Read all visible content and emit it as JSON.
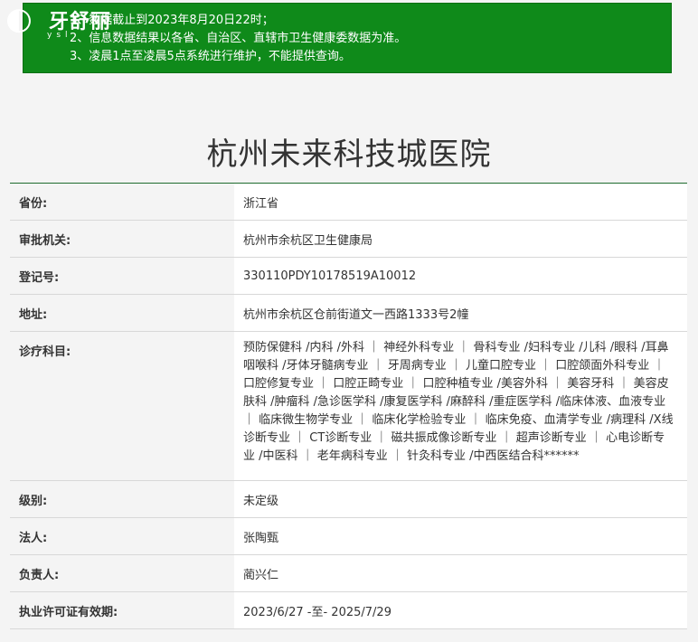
{
  "logo": {
    "mark": "◐",
    "text": "牙舒丽",
    "sub": "ysl"
  },
  "notice": {
    "lines": [
      "1、数据截止到2023年8月20日22时；",
      "2、信息数据结果以各省、自治区、直辖市卫生健康委数据为准。",
      "3、凌晨1点至凌晨5点系统进行维护，不能提供查询。"
    ]
  },
  "title": "杭州未来科技城医院",
  "rows": [
    {
      "label": "省份:",
      "value": "浙江省"
    },
    {
      "label": "审批机关:",
      "value": "杭州市余杭区卫生健康局"
    },
    {
      "label": "登记号:",
      "value": "330110PDY10178519A10012"
    },
    {
      "label": "地址:",
      "value": "杭州市余杭区仓前街道文一西路1333号2幢"
    },
    {
      "label": "诊疗科目:",
      "value": "预防保健科 /内科 /外科 ｜ 神经外科专业 ｜ 骨科专业 /妇科专业 /儿科 /眼科 /耳鼻咽喉科 /牙体牙髓病专业 ｜ 牙周病专业 ｜ 儿童口腔专业 ｜ 口腔颌面外科专业 ｜ 口腔修复专业 ｜ 口腔正畸专业 ｜ 口腔种植专业 /美容外科 ｜ 美容牙科 ｜ 美容皮肤科 /肿瘤科 /急诊医学科 /康复医学科 /麻醉科 /重症医学科 /临床体液、血液专业 ｜ 临床微生物学专业 ｜ 临床化学检验专业 ｜ 临床免疫、血清学专业 /病理科 /X线诊断专业 ｜ CT诊断专业 ｜ 磁共振成像诊断专业 ｜ 超声诊断专业 ｜ 心电诊断专业 /中医科 ｜ 老年病科专业 ｜ 针灸科专业 /中西医结合科******"
    },
    {
      "label": "级别:",
      "value": "未定级"
    },
    {
      "label": "法人:",
      "value": "张陶甄"
    },
    {
      "label": "负责人:",
      "value": "蔺兴仁"
    },
    {
      "label": "执业许可证有效期:",
      "value": "2023/6/27 -至- 2025/7/29"
    }
  ]
}
